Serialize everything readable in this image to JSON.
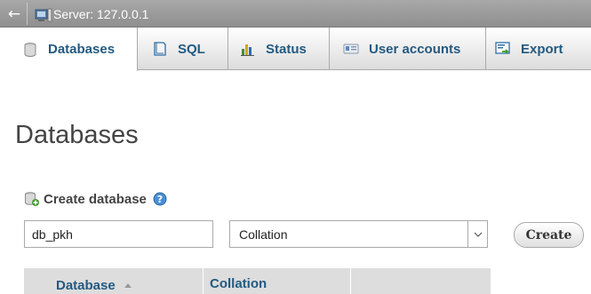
{
  "topbar": {
    "back_glyph": "←",
    "server_label": "Server: 127.0.0.1"
  },
  "tabs": [
    {
      "label": "Databases",
      "icon": "database-icon",
      "active": true
    },
    {
      "label": "SQL",
      "icon": "sql-icon",
      "active": false
    },
    {
      "label": "Status",
      "icon": "status-icon",
      "active": false
    },
    {
      "label": "User accounts",
      "icon": "user-accounts-icon",
      "active": false
    },
    {
      "label": "Export",
      "icon": "export-icon",
      "active": false
    }
  ],
  "main": {
    "title": "Databases",
    "create_section": {
      "label": "Create database",
      "db_name_value": "db_pkh",
      "collation_value": "Collation",
      "create_button": "Create"
    },
    "table": {
      "columns": [
        {
          "label": "Database",
          "sort_glyph": "▲"
        },
        {
          "label": "Collation",
          "sort_glyph": ""
        }
      ]
    }
  },
  "colors": {
    "link": "#235a81",
    "topbar": "#9a9a9a",
    "table_header": "#dddddd"
  }
}
